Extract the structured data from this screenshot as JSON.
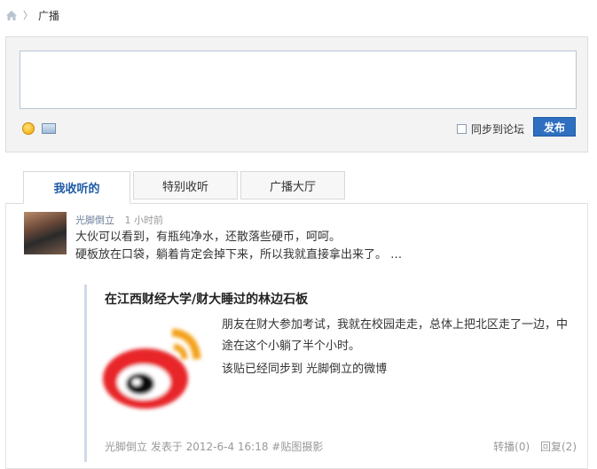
{
  "breadcrumb": {
    "sep": "〉",
    "current": "广播"
  },
  "composer": {
    "sync_label": "同步到论坛",
    "publish_label": "发布"
  },
  "tabs": [
    {
      "label": "我收听的"
    },
    {
      "label": "特别收听"
    },
    {
      "label": "广播大厅"
    }
  ],
  "post": {
    "author": "光脚倒立",
    "time": "1 小时前",
    "line1": "大伙可以看到，有瓶纯净水，还散落些硬币，呵呵。",
    "line2": "硬板放在口袋，躺着肯定会掉下来，所以我就直接拿出来了。 …",
    "quote": {
      "title": "在江西财经大学/财大睡过的林边石板",
      "body": "朋友在财大参加考试，我就在校园走走，总体上把北区走了一边，中途在这个小躺了半个小时。",
      "sync": "该贴已经同步到 光脚倒立的微博",
      "footer": "光脚倒立 发表于 2012-6-4 16:18 #贴图摄影",
      "forward": "转播(0)",
      "reply": "回复(2)"
    }
  }
}
